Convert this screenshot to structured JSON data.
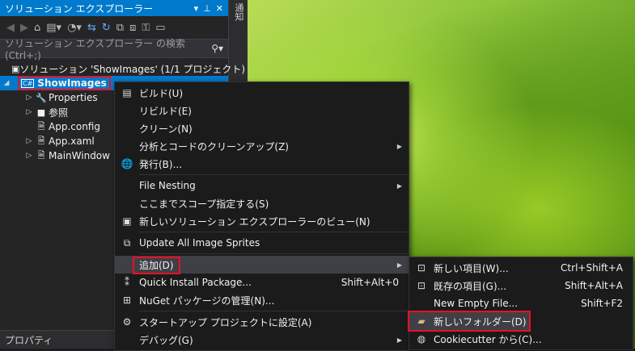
{
  "solution_explorer": {
    "title": "ソリューション エクスプローラー",
    "title_icons": [
      "▾",
      "⊥",
      "✕"
    ],
    "search_placeholder": "ソリューション エクスプローラー の検索 (Ctrl+;)",
    "solution_label": "ソリューション 'ShowImages' (1/1 プロジェクト)",
    "project": {
      "badge": "C#",
      "name": "ShowImages"
    },
    "items": [
      {
        "label": "Properties",
        "icon": "wrench-icon",
        "glyph": "🔧",
        "arrow": "▷"
      },
      {
        "label": "参照",
        "icon": "references-icon",
        "glyph": "■",
        "arrow": "▷"
      },
      {
        "label": "App.config",
        "icon": "config-file-icon",
        "glyph": "🗎",
        "arrow": ""
      },
      {
        "label": "App.xaml",
        "icon": "xaml-file-icon",
        "glyph": "🗎",
        "arrow": "▷"
      },
      {
        "label": "MainWindow",
        "icon": "xaml-file-icon",
        "glyph": "🗎",
        "arrow": "▷"
      }
    ]
  },
  "side_strip": {
    "label": "通知"
  },
  "properties_panel": {
    "label": "プロパティ"
  },
  "context_menu": {
    "items": [
      {
        "label": "ビルド(U)",
        "icon": "build-icon",
        "glyph": "▤",
        "shortcut": "",
        "submenu": false
      },
      {
        "label": "リビルド(E)",
        "icon": "",
        "glyph": "",
        "shortcut": "",
        "submenu": false
      },
      {
        "label": "クリーン(N)",
        "icon": "",
        "glyph": "",
        "shortcut": "",
        "submenu": false
      },
      {
        "label": "分析とコードのクリーンアップ(Z)",
        "icon": "",
        "glyph": "",
        "shortcut": "",
        "submenu": true
      },
      {
        "label": "発行(B)...",
        "icon": "globe-icon",
        "glyph": "🌐",
        "shortcut": "",
        "submenu": false,
        "sep_after": true
      },
      {
        "label": "File Nesting",
        "icon": "",
        "glyph": "",
        "shortcut": "",
        "submenu": true
      },
      {
        "label": "ここまでスコープ指定する(S)",
        "icon": "",
        "glyph": "",
        "shortcut": "",
        "submenu": false
      },
      {
        "label": "新しいソリューション エクスプローラーのビュー(N)",
        "icon": "new-view-icon",
        "glyph": "▣",
        "shortcut": "",
        "submenu": false,
        "sep_after": true
      },
      {
        "label": "Update All Image Sprites",
        "icon": "sprites-icon",
        "glyph": "⧉",
        "shortcut": "",
        "submenu": false,
        "sep_after": true
      },
      {
        "label": "追加(D)",
        "icon": "",
        "glyph": "",
        "shortcut": "",
        "submenu": true,
        "highlight": true
      },
      {
        "label": "Quick Install Package...",
        "icon": "package-icon",
        "glyph": "⁑",
        "shortcut": "Shift+Alt+0",
        "submenu": false
      },
      {
        "label": "NuGet パッケージの管理(N)...",
        "icon": "nuget-icon",
        "glyph": "⊞",
        "shortcut": "",
        "submenu": false,
        "sep_after": true
      },
      {
        "label": "スタートアップ プロジェクトに設定(A)",
        "icon": "gear-icon",
        "glyph": "⚙",
        "shortcut": "",
        "submenu": false
      },
      {
        "label": "デバッグ(G)",
        "icon": "",
        "glyph": "",
        "shortcut": "",
        "submenu": true
      }
    ]
  },
  "add_submenu": {
    "items": [
      {
        "label": "新しい項目(W)...",
        "icon": "new-item-icon",
        "glyph": "⊡",
        "shortcut": "Ctrl+Shift+A"
      },
      {
        "label": "既存の項目(G)...",
        "icon": "existing-item-icon",
        "glyph": "⊡",
        "shortcut": "Shift+Alt+A"
      },
      {
        "label": "New Empty File...",
        "icon": "",
        "glyph": "",
        "shortcut": "Shift+F2"
      },
      {
        "label": "新しいフォルダー(D)",
        "icon": "new-folder-icon",
        "glyph": "▰",
        "shortcut": "",
        "highlight": true
      },
      {
        "label": "Cookiecutter から(C)...",
        "icon": "cookiecutter-icon",
        "glyph": "◍",
        "shortcut": ""
      }
    ]
  }
}
